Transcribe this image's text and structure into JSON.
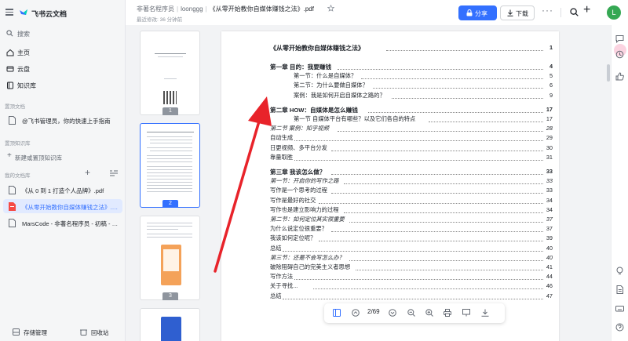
{
  "sidebar": {
    "app_name": "飞书云文档",
    "search_label": "搜索",
    "nav": [
      {
        "label": "主页"
      },
      {
        "label": "云盘"
      },
      {
        "label": "知识库"
      }
    ],
    "pinned_docs_title": "置顶文档",
    "pinned_doc": "@飞书管理员，你的快速上手指南",
    "pinned_kb_title": "置顶知识库",
    "new_pinned_kb": "新建或置顶知识库",
    "my_files_title": "我的文档库",
    "files": [
      {
        "label": "《从 0 到 1 打造个人品牌》.pdf"
      },
      {
        "label": "《从零开始教你自媒体赚钱之法》.pdf"
      },
      {
        "label": "MarsCode - 非著名程序员 - 初稿 - 20..."
      }
    ],
    "storage_label": "存储管理",
    "recycle_label": "回收站"
  },
  "header": {
    "crumb1": "非著名程序员",
    "crumb2": "loonggg",
    "crumb3": "《从零开始教你自媒体赚钱之法》.pdf",
    "modified": "最近修改: 36 分钟前",
    "share_label": "分享",
    "download_label": "下载",
    "avatar_letter": "L"
  },
  "thumbnails": [
    {
      "num": "1"
    },
    {
      "num": "2"
    },
    {
      "num": "3"
    }
  ],
  "toc": {
    "main_title": "《从零开始教你自媒体赚钱之法》",
    "main_page": "1",
    "rows": [
      {
        "text": "第一章 目的：我要赚钱",
        "page": "4",
        "indent": 0,
        "style": "bold"
      },
      {
        "text": "第一节：什么是自媒体？",
        "page": "5",
        "indent": 1,
        "style": ""
      },
      {
        "text": "第二节：为什么要做自媒体？",
        "page": "6",
        "indent": 1,
        "style": ""
      },
      {
        "text": "案例：我是如何开启自媒体之路的？",
        "page": "9",
        "indent": 1,
        "style": ""
      },
      {
        "text": "第二章 HOW：自媒体是怎么赚钱",
        "page": "17",
        "indent": 0,
        "style": "bold"
      },
      {
        "text": "第一节 自媒体平台有哪些？以及它们各自的特点",
        "page": "17",
        "indent": 1,
        "style": ""
      },
      {
        "text": "第二节 案例：知乎视频",
        "page": "28",
        "indent": 0,
        "style": "it"
      },
      {
        "text": "自动生成",
        "page": "29",
        "indent": 0,
        "style": ""
      },
      {
        "text": "日更视频、多平台分发",
        "page": "30",
        "indent": 0,
        "style": ""
      },
      {
        "text": "靠量取胜",
        "page": "31",
        "indent": 0,
        "style": ""
      },
      {
        "text": "第三章 我该怎么做？",
        "page": "33",
        "indent": 0,
        "style": "bold"
      },
      {
        "text": "第一节：开启你的写作之路",
        "page": "33",
        "indent": 0,
        "style": "it"
      },
      {
        "text": "写作是一个思考的过程",
        "page": "33",
        "indent": 0,
        "style": ""
      },
      {
        "text": "写作是最好的社交",
        "page": "34",
        "indent": 0,
        "style": ""
      },
      {
        "text": "写作也是建立影响力的过程",
        "page": "34",
        "indent": 0,
        "style": ""
      },
      {
        "text": "第二节：如何定位其实很重要",
        "page": "37",
        "indent": 0,
        "style": "it"
      },
      {
        "text": "为什么说定位很重要？",
        "page": "37",
        "indent": 0,
        "style": ""
      },
      {
        "text": "我该如何定位呢？",
        "page": "39",
        "indent": 0,
        "style": ""
      },
      {
        "text": "总结",
        "page": "40",
        "indent": 0,
        "style": ""
      },
      {
        "text": "第三节：还是不会写怎么办？",
        "page": "40",
        "indent": 0,
        "style": "it"
      },
      {
        "text": "破除阻碍自己的完美主义者思想",
        "page": "41",
        "indent": 0,
        "style": ""
      },
      {
        "text": "写作方法",
        "page": "44",
        "indent": 0,
        "style": ""
      },
      {
        "text": "关于寻找...",
        "page": "46",
        "indent": 0,
        "style": ""
      },
      {
        "text": "总结",
        "page": "47",
        "indent": 0,
        "style": ""
      }
    ]
  },
  "toolbar": {
    "page_indicator": "2/69"
  },
  "colors": {
    "accent": "#3370ff",
    "arrow": "#e8232a",
    "avatar": "#35a853"
  }
}
